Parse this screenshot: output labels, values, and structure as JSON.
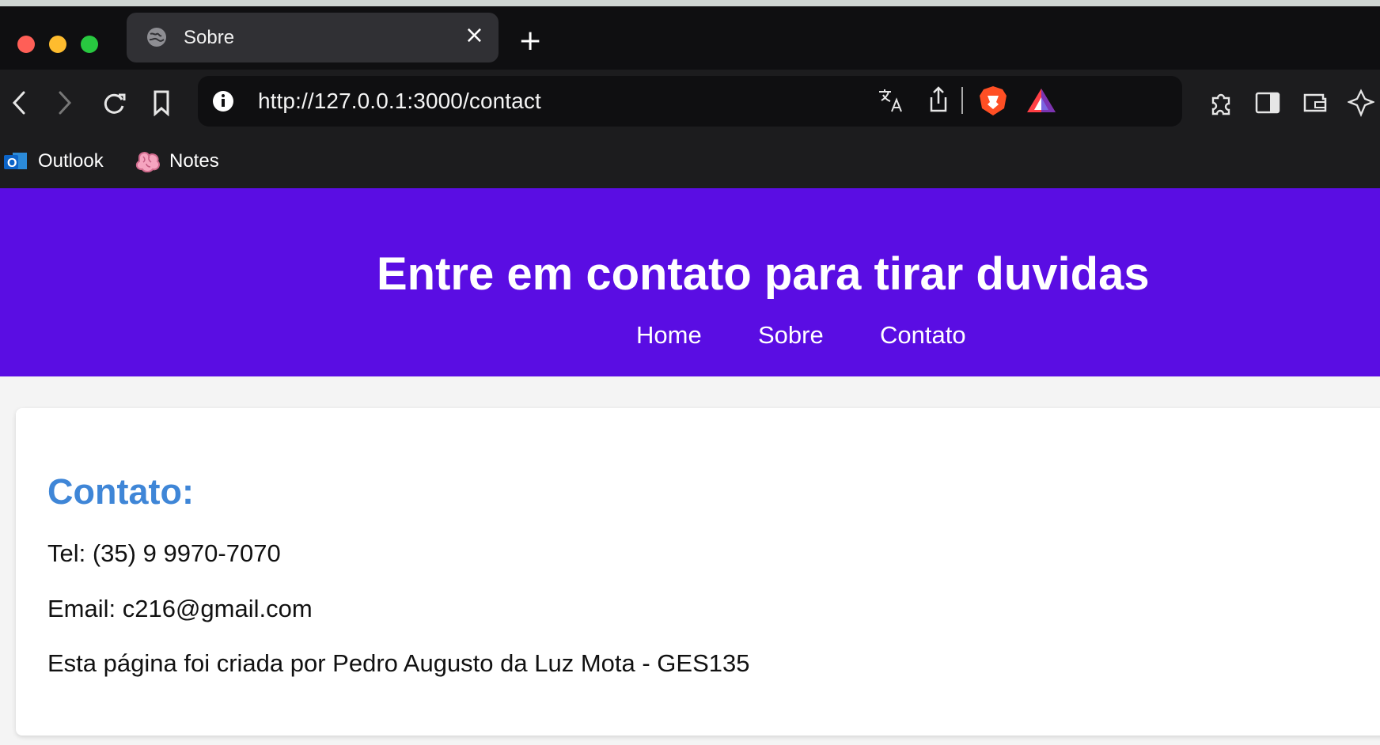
{
  "browser": {
    "tab_title": "Sobre",
    "url": "http://127.0.0.1:3000/contact",
    "bookmarks": [
      {
        "label": "Outlook",
        "icon": "outlook-icon"
      },
      {
        "label": "Notes",
        "icon": "brain-icon"
      }
    ],
    "icons": [
      "back-icon",
      "forward-icon",
      "reload-icon",
      "bookmark-icon",
      "info-icon",
      "translate-icon",
      "share-icon",
      "brave-shield-icon",
      "brave-rewards-icon",
      "extensions-icon",
      "sidebar-icon",
      "wallet-icon",
      "leo-icon"
    ]
  },
  "header": {
    "title": "Entre em contato para tirar duvidas",
    "nav": [
      "Home",
      "Sobre",
      "Contato"
    ],
    "background": "#5a0de3"
  },
  "contact": {
    "heading": "Contato:",
    "phone": "Tel: (35) 9 9970-7070",
    "email": "Email: c216@gmail.com",
    "author": "Esta página foi criada por Pedro Augusto da Luz Mota - GES135",
    "heading_color": "#3f86d7"
  }
}
